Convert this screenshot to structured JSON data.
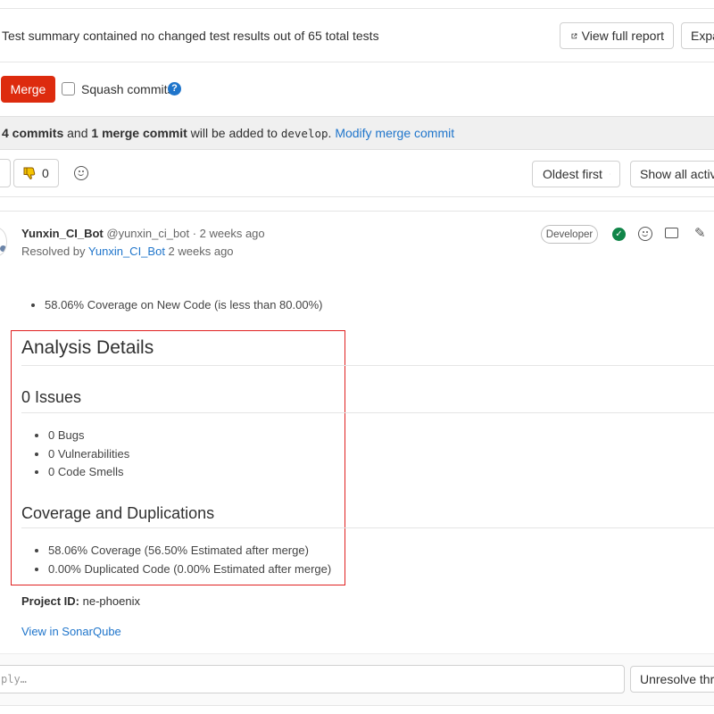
{
  "report": {
    "summary": "Test summary contained no changed test results out of 65 total tests",
    "view_full_report": "View full report",
    "expand_label": "Expa"
  },
  "merge": {
    "merge_label": "Merge",
    "squash_label": "Squash commits",
    "help_glyph": "?"
  },
  "commit_info": {
    "commits": "4 commits",
    "and": " and ",
    "merge_commit": "1 merge commit",
    "will_be_added": " will be added to ",
    "branch": "develop",
    "period": ". ",
    "modify_link": "Modify merge commit"
  },
  "toolbar": {
    "thumbs_down_count": "0",
    "sort_label": "Oldest first",
    "show_all_label": "Show all activit"
  },
  "note": {
    "author_name": "Yunxin_CI_Bot",
    "author_handle": "@yunxin_ci_bot",
    "separator": " · ",
    "time": "2 weeks ago",
    "resolved_by_prefix": "Resolved by ",
    "resolved_by_name": "Yunxin_CI_Bot",
    "resolved_time": " 2 weeks ago",
    "role": "Developer"
  },
  "body": {
    "coverage_bullet": "58.06% Coverage on New Code (is less than 80.00%)",
    "analysis_title": "Analysis Details",
    "issues_title": "0 Issues",
    "issues": [
      "0 Bugs",
      "0 Vulnerabilities",
      "0 Code Smells"
    ],
    "coverage_title": "Coverage and Duplications",
    "coverage_items": [
      "58.06% Coverage (56.50% Estimated after merge)",
      "0.00% Duplicated Code (0.00% Estimated after merge)"
    ],
    "project_id_label": "Project ID:",
    "project_id_value": " ne-phoenix",
    "sonar_link": "View in SonarQube"
  },
  "reply": {
    "placeholder": "ply…",
    "unresolve_label": "Unresolve thre"
  }
}
